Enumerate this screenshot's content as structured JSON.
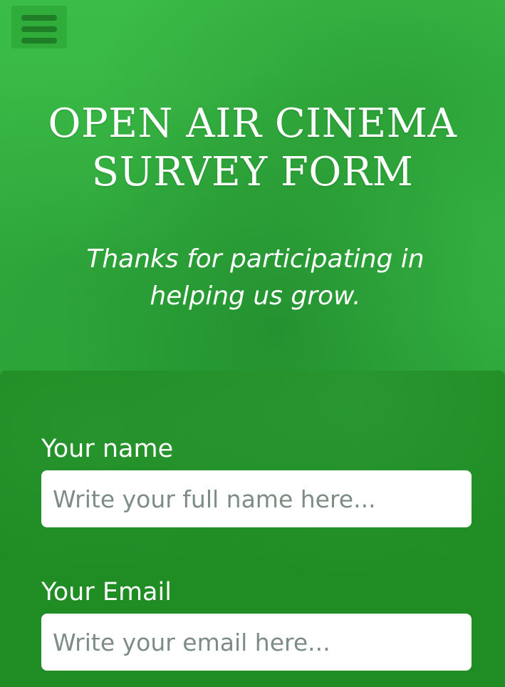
{
  "header": {
    "menu_icon": "hamburger-menu-icon",
    "title_line1": "OPEN AIR CINEMA",
    "title_line2": "SURVEY FORM",
    "description": "Thanks for participating in helping us grow."
  },
  "form": {
    "name": {
      "label": "Your name",
      "placeholder": "Write your full name here...",
      "value": ""
    },
    "email": {
      "label": "Your Email",
      "placeholder": "Write your email here...",
      "value": ""
    }
  },
  "colors": {
    "hero_background": "#3ab94a",
    "form_background": "#1f8c24",
    "menu_bar": "#1f7d28",
    "text": "#ffffff",
    "placeholder": "#7d8d86"
  }
}
